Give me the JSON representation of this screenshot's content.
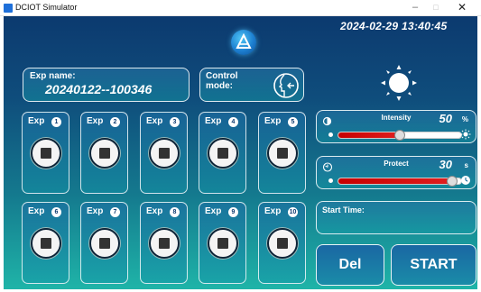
{
  "window": {
    "title": "DCIOT Simulator",
    "controls": {
      "minimize": "–",
      "maximize": "□",
      "close": "✕"
    }
  },
  "header": {
    "datetime": "2024-02-29 13:40:45",
    "logo_icon": "a-logo-icon"
  },
  "experiment": {
    "name_label": "Exp name:",
    "name_value": "20240122--100346"
  },
  "control": {
    "label_line1": "Control",
    "label_line2": "mode:",
    "mode_icon": "head-arrow-icon"
  },
  "light_icon": "sun-icon",
  "tiles": [
    {
      "label": "Exp",
      "num": "1"
    },
    {
      "label": "Exp",
      "num": "2"
    },
    {
      "label": "Exp",
      "num": "3"
    },
    {
      "label": "Exp",
      "num": "4"
    },
    {
      "label": "Exp",
      "num": "5"
    },
    {
      "label": "Exp",
      "num": "6"
    },
    {
      "label": "Exp",
      "num": "7"
    },
    {
      "label": "Exp",
      "num": "8"
    },
    {
      "label": "Exp",
      "num": "9"
    },
    {
      "label": "Exp",
      "num": "10"
    }
  ],
  "intensity": {
    "title": "Intensity",
    "value": "50",
    "unit": "%",
    "fraction": 0.5
  },
  "protect": {
    "title": "Protect",
    "value": "30",
    "unit": "s",
    "fraction": 0.92
  },
  "start_time": {
    "label": "Start Time:",
    "value": ""
  },
  "buttons": {
    "del": "Del",
    "start": "START"
  },
  "colors": {
    "bg_top": "#0c3a6f",
    "bg_bottom": "#1fb4a8",
    "slider_fill": "#c60000"
  }
}
